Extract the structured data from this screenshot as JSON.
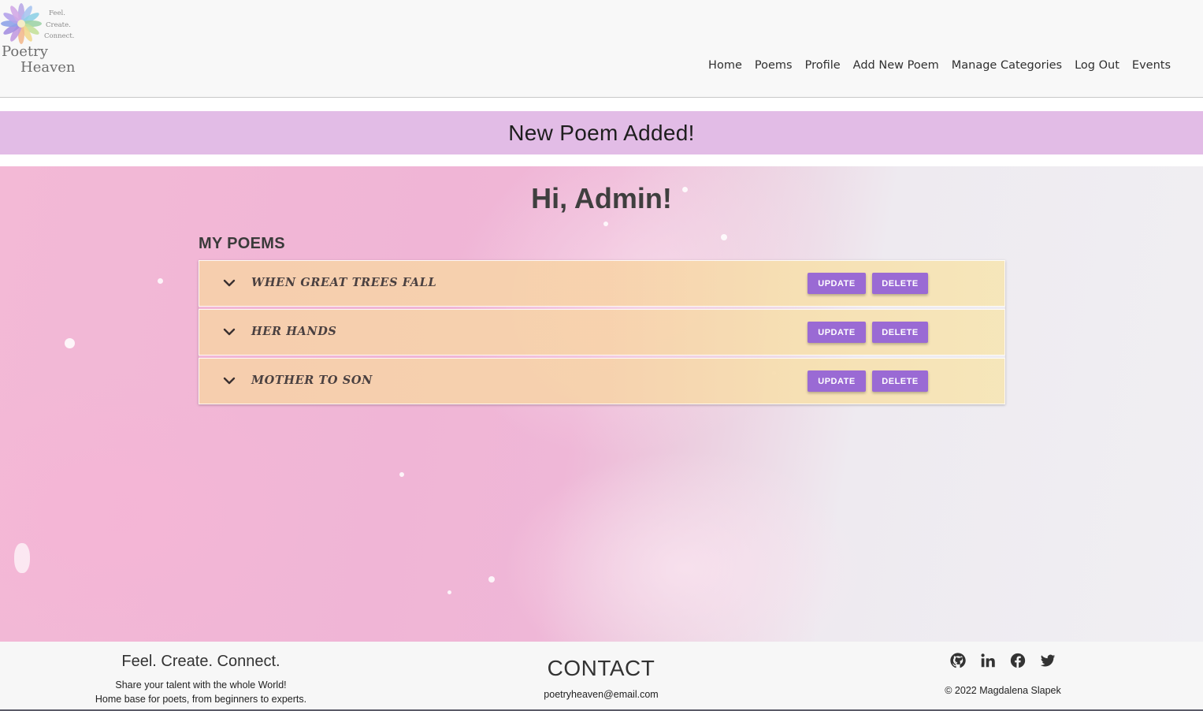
{
  "brand": {
    "tagline_words": [
      "Feel.",
      "Create.",
      "Connect."
    ],
    "name_line1": "Poetry",
    "name_line2": "Heaven"
  },
  "nav": {
    "items": [
      {
        "label": "Home"
      },
      {
        "label": "Poems"
      },
      {
        "label": "Profile"
      },
      {
        "label": "Add New Poem"
      },
      {
        "label": "Manage Categories"
      },
      {
        "label": "Log Out"
      },
      {
        "label": "Events"
      }
    ]
  },
  "alert": {
    "message": "New Poem Added!",
    "color": "#e2bce6"
  },
  "main": {
    "greeting": "Hi, Admin!",
    "section_title": "MY POEMS",
    "poems": [
      {
        "title": "WHEN GREAT TREES FALL",
        "update_label": "UPDATE",
        "delete_label": "DELETE",
        "expand_icon": "chevron-down-icon"
      },
      {
        "title": "HER HANDS",
        "update_label": "UPDATE",
        "delete_label": "DELETE",
        "expand_icon": "chevron-down-icon"
      },
      {
        "title": "MOTHER TO SON",
        "update_label": "UPDATE",
        "delete_label": "DELETE",
        "expand_icon": "chevron-down-icon"
      }
    ],
    "button_color": "#9a6ad4"
  },
  "footer": {
    "tagline": "Feel. Create. Connect.",
    "line1": "Share your talent with the whole World!",
    "line2": "Home base for poets, from beginners to experts.",
    "contact_heading": "CONTACT",
    "email": "poetryheaven@email.com",
    "social_icons": [
      "github-icon",
      "linkedin-icon",
      "facebook-icon",
      "twitter-icon"
    ],
    "copyright": "© 2022 Magdalena Slapek"
  }
}
